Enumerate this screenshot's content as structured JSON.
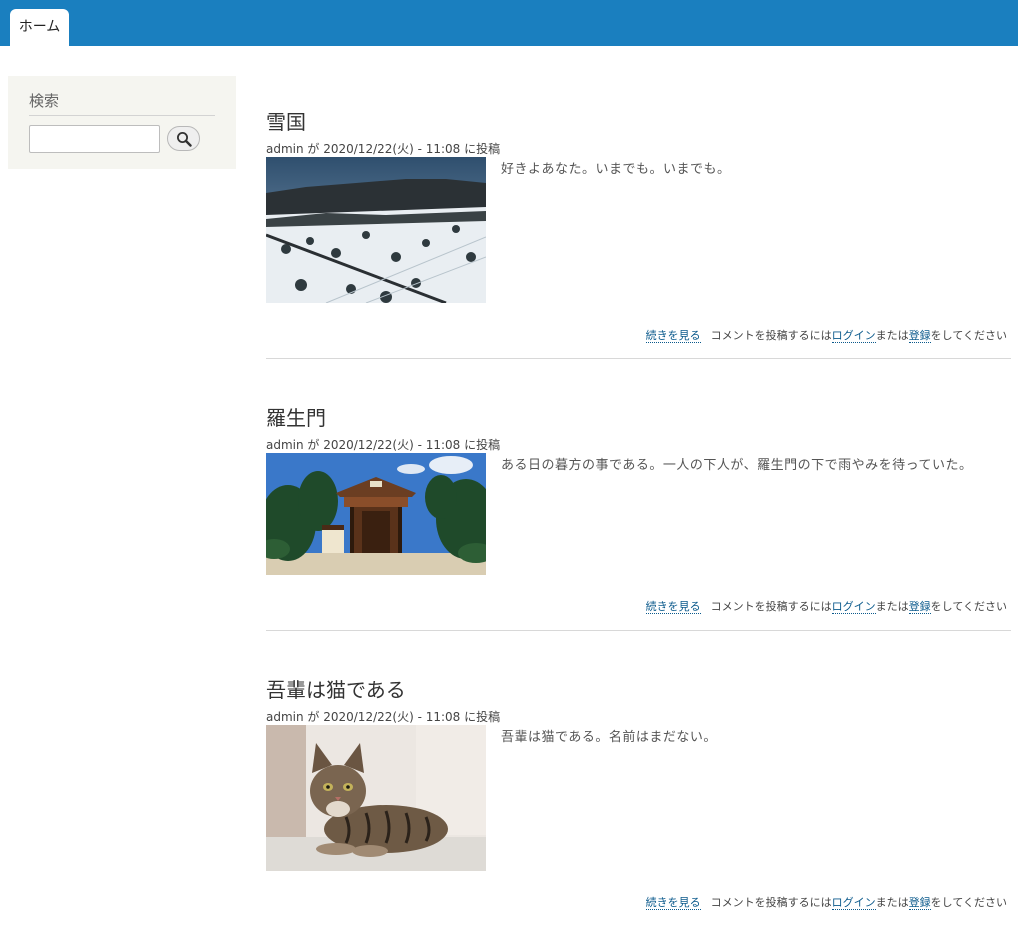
{
  "nav": {
    "home_tab": "ホーム"
  },
  "sidebar": {
    "title": "検索",
    "search_value": "",
    "search_placeholder": ""
  },
  "articles": [
    {
      "title": "雪国",
      "meta": "admin が 2020/12/22(火) - 11:08 に投稿",
      "body": "好きよあなた。いまでも。いまでも。",
      "image": "snow-village-photo"
    },
    {
      "title": "羅生門",
      "meta": "admin が 2020/12/22(火) - 11:08 に投稿",
      "body": "ある日の暮方の事である。一人の下人が、羅生門の下で雨やみを待っていた。",
      "image": "temple-gate-photo"
    },
    {
      "title": "吾輩は猫である",
      "meta": "admin が 2020/12/22(火) - 11:08 に投稿",
      "body": "吾輩は猫である。名前はまだない。",
      "image": "tabby-cat-photo"
    }
  ],
  "links": {
    "read_more": "続きを見る",
    "comment_prefix": "コメントを投稿するには",
    "login": "ログイン",
    "or": "または",
    "register": "登録",
    "comment_suffix": "をしてください"
  },
  "colors": {
    "topbar": "#1a7fbf",
    "link": "#0b5a8c",
    "sidebar_bg": "#f5f5f0"
  }
}
